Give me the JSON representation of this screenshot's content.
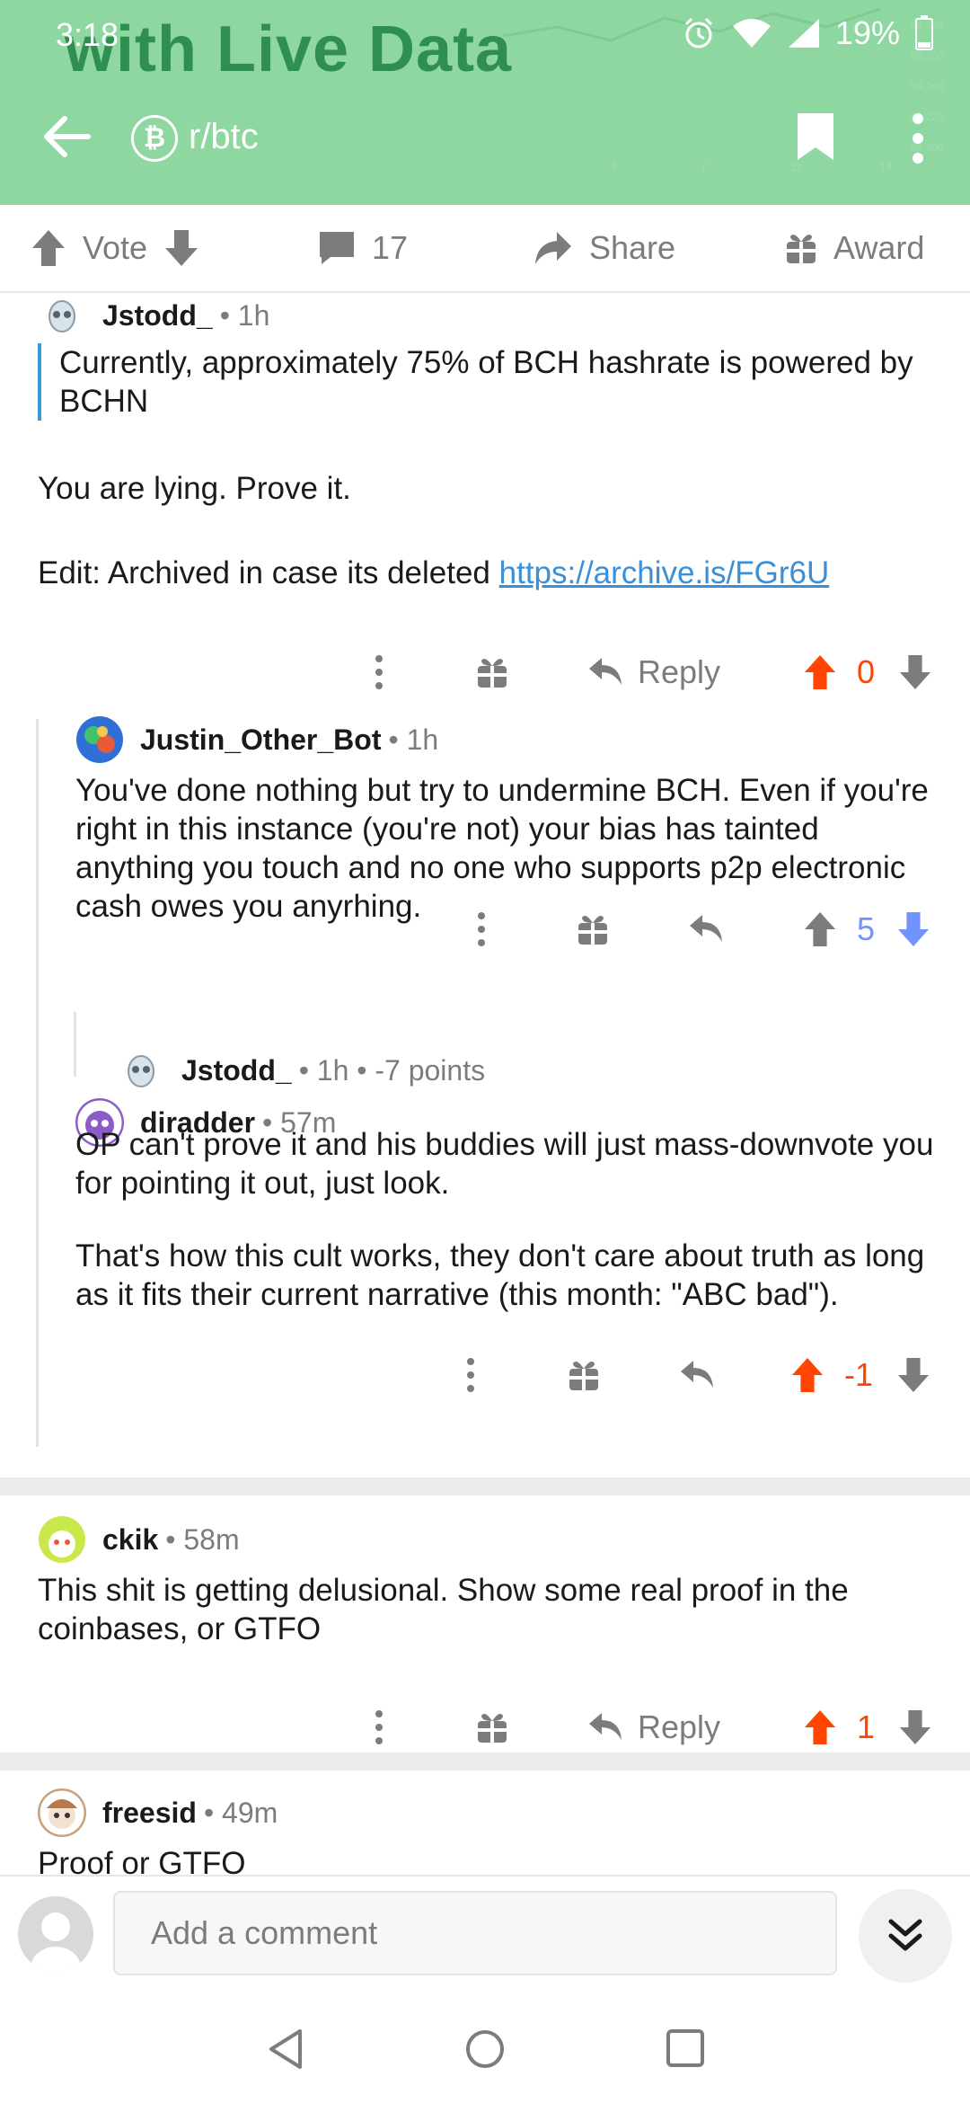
{
  "status_bar": {
    "time": "3:18",
    "battery": "19%"
  },
  "background": {
    "banner_text": "with Live Data",
    "chart_labels": [
      "$9,280",
      "$9,260",
      "$9,240",
      "$9,220",
      "$9,200",
      "4",
      "7",
      "11",
      "14"
    ]
  },
  "app_bar": {
    "subreddit": "r/btc"
  },
  "action_bar": {
    "vote_label": "Vote",
    "comment_count": "17",
    "share_label": "Share",
    "award_label": "Award"
  },
  "comments": [
    {
      "author": "Jstodd_",
      "age": "• 1h",
      "quote": "Currently, approximately 75% of BCH hashrate is powered by BCHN",
      "text1": "You are lying. Prove it.",
      "text2_prefix": "Edit: Archived in case its deleted ",
      "link": "https://archive.is/FGr6U",
      "reply_label": "Reply",
      "score": "0"
    },
    {
      "author": "Justin_Other_Bot",
      "age": "• 1h",
      "text": "You've done nothing but try to undermine BCH. Even if you're right in this instance (you're not) your bias has tainted anything you touch and no one who supports p2p electronic cash owes you anyrhing.",
      "score": "5"
    },
    {
      "author": "Jstodd_",
      "age": "• 1h • -7 points"
    },
    {
      "author": "diradder",
      "age": "• 57m",
      "text1": "OP can't prove it and his buddies will just mass-downvote you for pointing it out, just look.",
      "text2": "That's how this cult works, they don't care about truth as long as it fits their current narrative (this month: \"ABC bad\").",
      "score": "-1"
    },
    {
      "author": "ckik",
      "age": "• 58m",
      "text": "This shit is getting delusional. Show some real proof in the coinbases, or GTFO",
      "reply_label": "Reply",
      "score": "1"
    },
    {
      "author": "freesid",
      "age": "• 49m",
      "text": "Proof or GTFO"
    }
  ],
  "composer": {
    "placeholder": "Add a comment"
  },
  "colors": {
    "header_green": "#8fd7a0",
    "upvote_orange": "#ff4500",
    "downvote_blue": "#7193ff",
    "link_blue": "#3a8fd8"
  },
  "icons": [
    "back-arrow-icon",
    "bitcoin-icon",
    "bookmark-icon",
    "more-vert-icon",
    "upvote-icon",
    "downvote-icon",
    "comment-icon",
    "share-icon",
    "gift-icon",
    "reply-icon",
    "chevron-double-down-icon",
    "nav-back-icon",
    "nav-home-icon",
    "nav-recents-icon"
  ]
}
